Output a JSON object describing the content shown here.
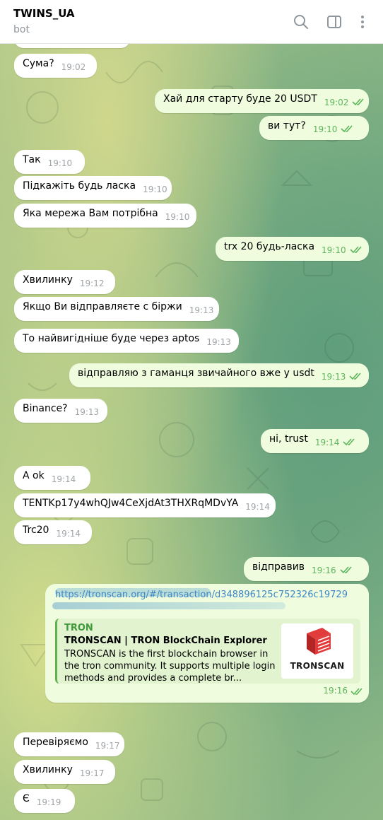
{
  "header": {
    "title": "TWINS_UA",
    "subtitle": "bot",
    "icons": [
      "search-icon",
      "sidebar-toggle-icon",
      "more-vertical-icon"
    ]
  },
  "messages": [
    {
      "dir": "in",
      "text": "Сума?",
      "time": "19:02"
    },
    {
      "dir": "out",
      "text": "Хай для старту буде 20 USDT",
      "time": "19:02"
    },
    {
      "dir": "out",
      "text": "ви тут?",
      "time": "19:10"
    },
    {
      "dir": "in",
      "text": "Так",
      "time": "19:10"
    },
    {
      "dir": "in",
      "text": "Підкажіть будь ласка",
      "time": "19:10"
    },
    {
      "dir": "in",
      "text": "Яка мережа Вам потрібна",
      "time": "19:10"
    },
    {
      "dir": "out",
      "text": "trx 20 будь-ласка",
      "time": "19:10"
    },
    {
      "dir": "in",
      "text": "Хвилинку",
      "time": "19:12"
    },
    {
      "dir": "in",
      "text": "Якщо Ви відправляєте с біржи",
      "time": "19:13"
    },
    {
      "dir": "in",
      "text": "То найвигідніше буде через aptos",
      "time": "19:13"
    },
    {
      "dir": "out",
      "text": "відправляю з гаманця звичайного вже у usdt",
      "time": "19:13"
    },
    {
      "dir": "in",
      "text": "Binance?",
      "time": "19:13"
    },
    {
      "dir": "out",
      "text": "ні, trust",
      "time": "19:14"
    },
    {
      "dir": "in",
      "text": "A ok",
      "time": "19:14"
    },
    {
      "dir": "in",
      "text": "TENTKp17y4whQJw4CeXjdAt3THXRqMDvYA",
      "time": "19:14"
    },
    {
      "dir": "in",
      "text": "Trc20",
      "time": "19:14"
    },
    {
      "dir": "out",
      "text": "відправив",
      "time": "19:16"
    }
  ],
  "link_message": {
    "url_visible": "https://tronscan.org/#/transaction/d348896125c752326c19729",
    "preview": {
      "site": "TRON",
      "title": "TRONSCAN | TRON BlockChain Explorer",
      "description": "TRONSCAN is the first blockchain browser in the tron community. It supports multiple login methods and provides a complete br...",
      "thumb_text": "TRONSCAN"
    },
    "time": "19:16"
  },
  "messages_after": [
    {
      "dir": "in",
      "text": "Перевіряємо",
      "time": "19:17"
    },
    {
      "dir": "in",
      "text": "Хвилинку",
      "time": "19:17"
    },
    {
      "dir": "in",
      "text": "Є",
      "time": "19:19"
    }
  ],
  "colors": {
    "incoming_bubble": "#ffffff",
    "outgoing_bubble": "#effdde",
    "outgoing_time": "#5db55b",
    "link": "#3e86c6",
    "preview_accent": "#63b04f"
  }
}
